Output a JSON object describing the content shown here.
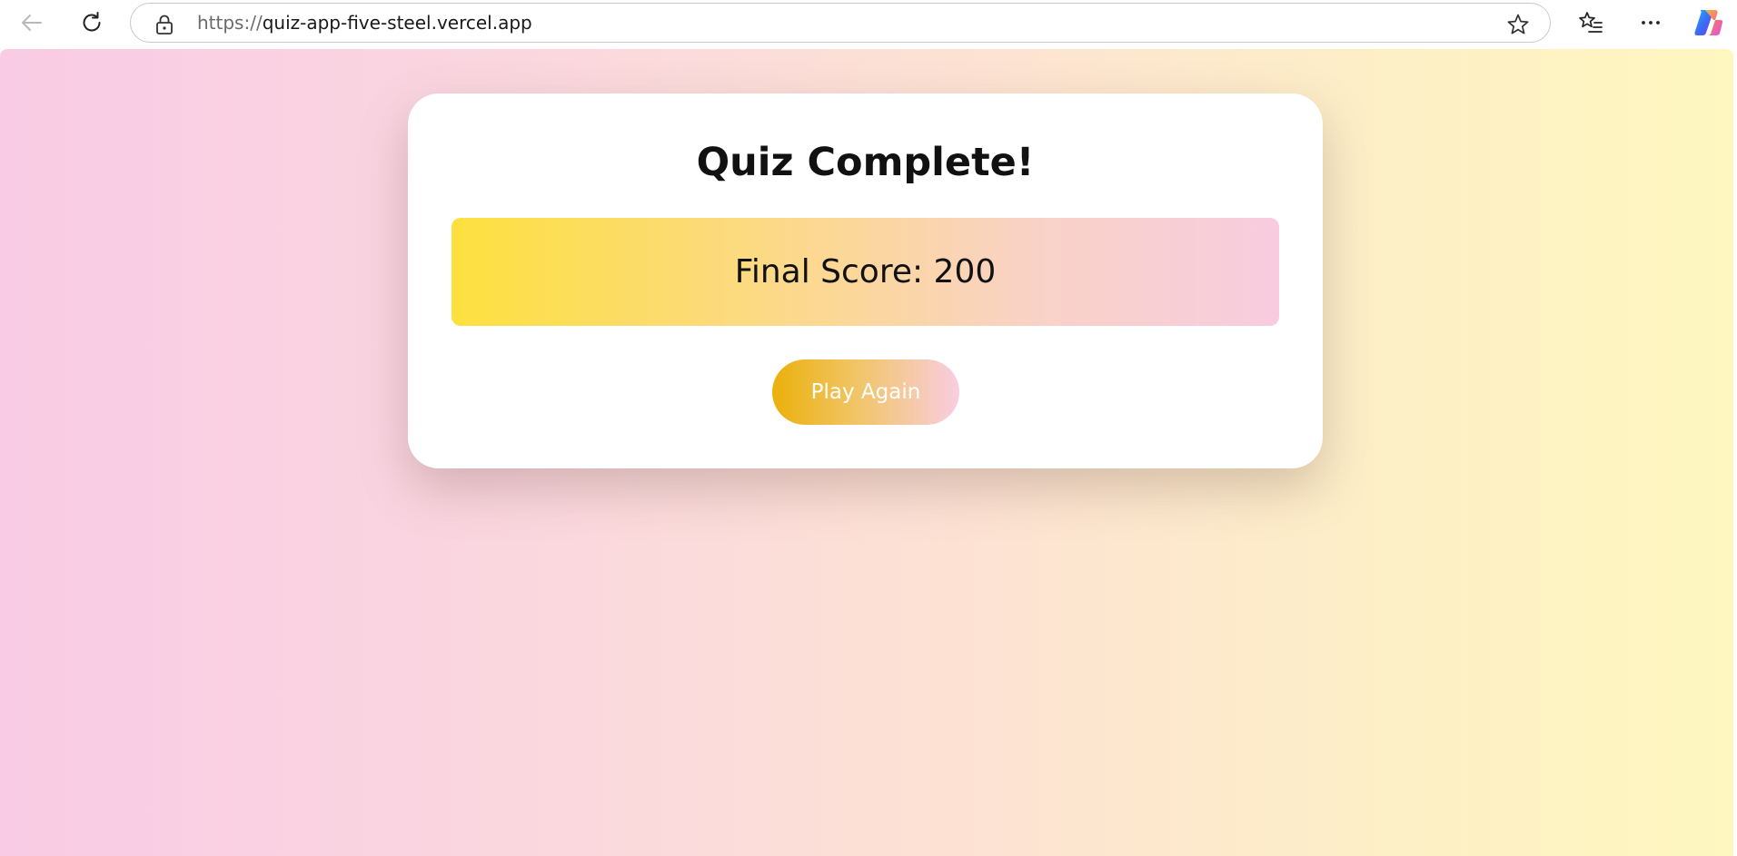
{
  "browser": {
    "url_scheme": "https://",
    "url_host": "quiz-app-five-steel.vercel.app",
    "icons": {
      "back": "arrow-left-icon",
      "reload": "reload-icon",
      "lock": "lock-icon",
      "favorite": "star-icon",
      "favorites_list": "favorites-list-icon",
      "more": "more-icon",
      "copilot": "copilot-icon"
    }
  },
  "quiz": {
    "title": "Quiz Complete!",
    "score_label": "Final Score: 200",
    "score_value": 200,
    "play_again_label": "Play Again"
  },
  "colors": {
    "page_gradient": [
      "#f9cbe5",
      "#fad7df",
      "#fde2d4",
      "#fdefc6",
      "#fef7c0"
    ],
    "score_gradient": [
      "#fde03e",
      "#fcd98a",
      "#f9d2c6",
      "#f8ccdf"
    ],
    "button_gradient": [
      "#ebb00b",
      "#f1c566",
      "#f9cde0"
    ],
    "card": "#ffffff",
    "text": "#111111"
  }
}
